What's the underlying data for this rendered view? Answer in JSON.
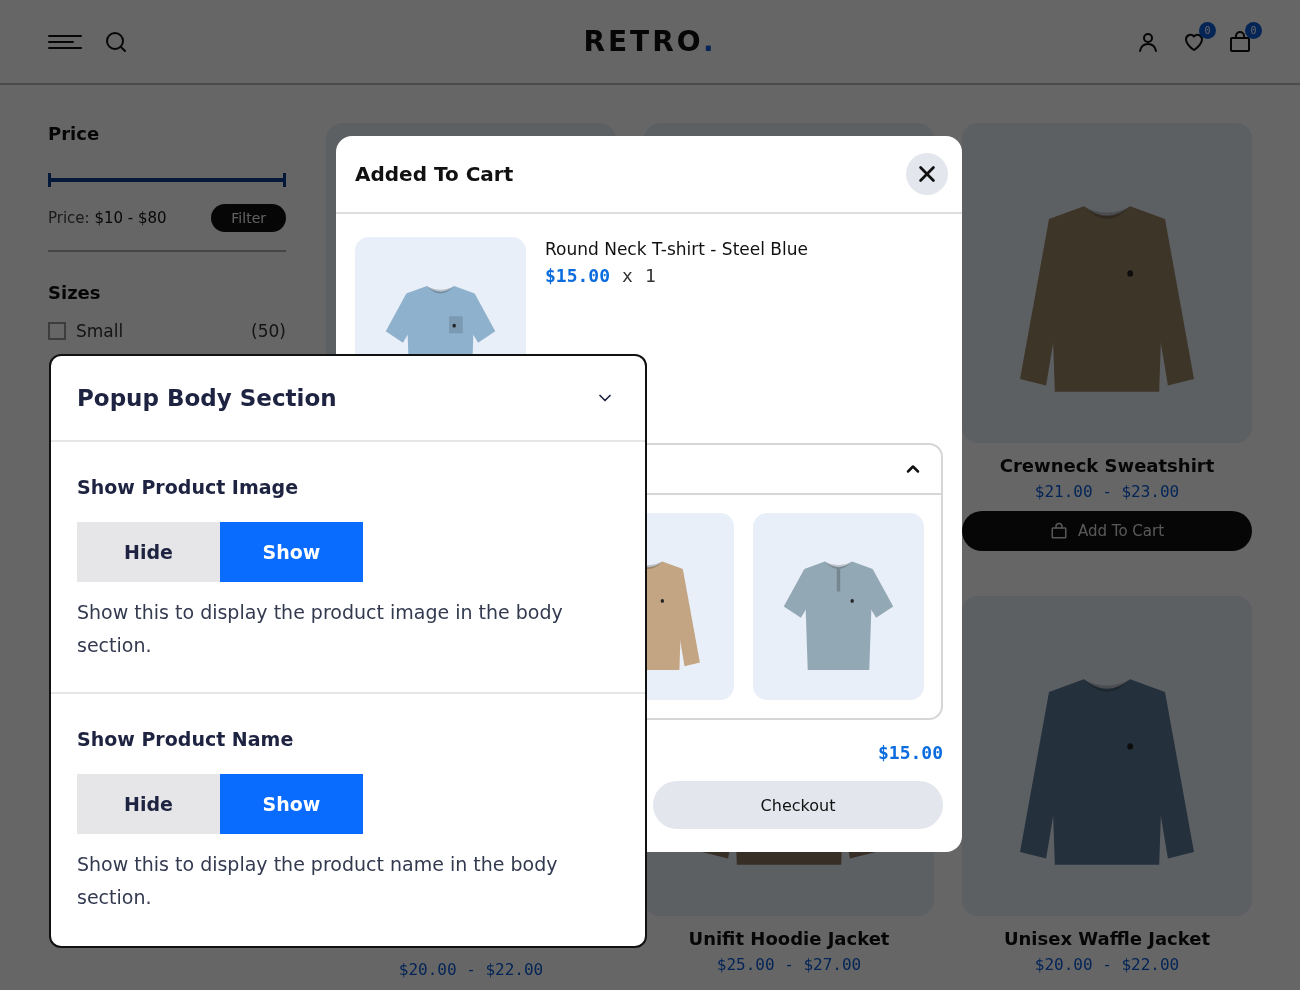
{
  "header": {
    "logo": "RETRO",
    "logo_dot": ".",
    "wishlist_count": "0",
    "cart_count": "0"
  },
  "sidebar": {
    "price_title": "Price",
    "price_slider": {
      "level": 1
    },
    "price_label": "Price:",
    "price_range": "$10 - $80",
    "filter_button": "Filter",
    "sizes_title": "Sizes",
    "sizes": [
      {
        "label": "Small",
        "count": "(50)",
        "checked": false
      }
    ]
  },
  "products": [
    {
      "kind": "covered"
    },
    {
      "kind": "covered"
    },
    {
      "kind": "picture",
      "name": "Crewneck Sweatshirt",
      "price": "$21.00 - $23.00",
      "button": "Add To Cart"
    },
    {
      "kind": "covered",
      "price": "$20.00 - $22.00"
    },
    {
      "kind": "picture",
      "name": "Unifit Hoodie Jacket",
      "price": "$25.00 - $27.00"
    },
    {
      "kind": "picture",
      "name": "Unisex Waffle Jacket",
      "price": "$20.00 - $22.00"
    }
  ],
  "cart_popup": {
    "title": "Added To Cart",
    "item": {
      "name": "Round Neck T-shirt - Steel Blue",
      "price": "$15.00",
      "quantity_sign": "x",
      "quantity": "1"
    },
    "related_expanded": true,
    "total": "$15.00",
    "checkout": "Checkout"
  },
  "settings_panel": {
    "title": "Popup Body Section",
    "expanded": true,
    "settings": [
      {
        "label": "Show Product Image",
        "options": [
          {
            "label": "Hide",
            "selected": false
          },
          {
            "label": "Show",
            "selected": true
          }
        ],
        "description": "Show this to display the product image in the body section."
      },
      {
        "label": "Show Product Name",
        "options": [
          {
            "label": "Hide",
            "selected": false
          },
          {
            "label": "Show",
            "selected": true
          }
        ],
        "description": "Show this to display the product name in the body section."
      }
    ]
  }
}
